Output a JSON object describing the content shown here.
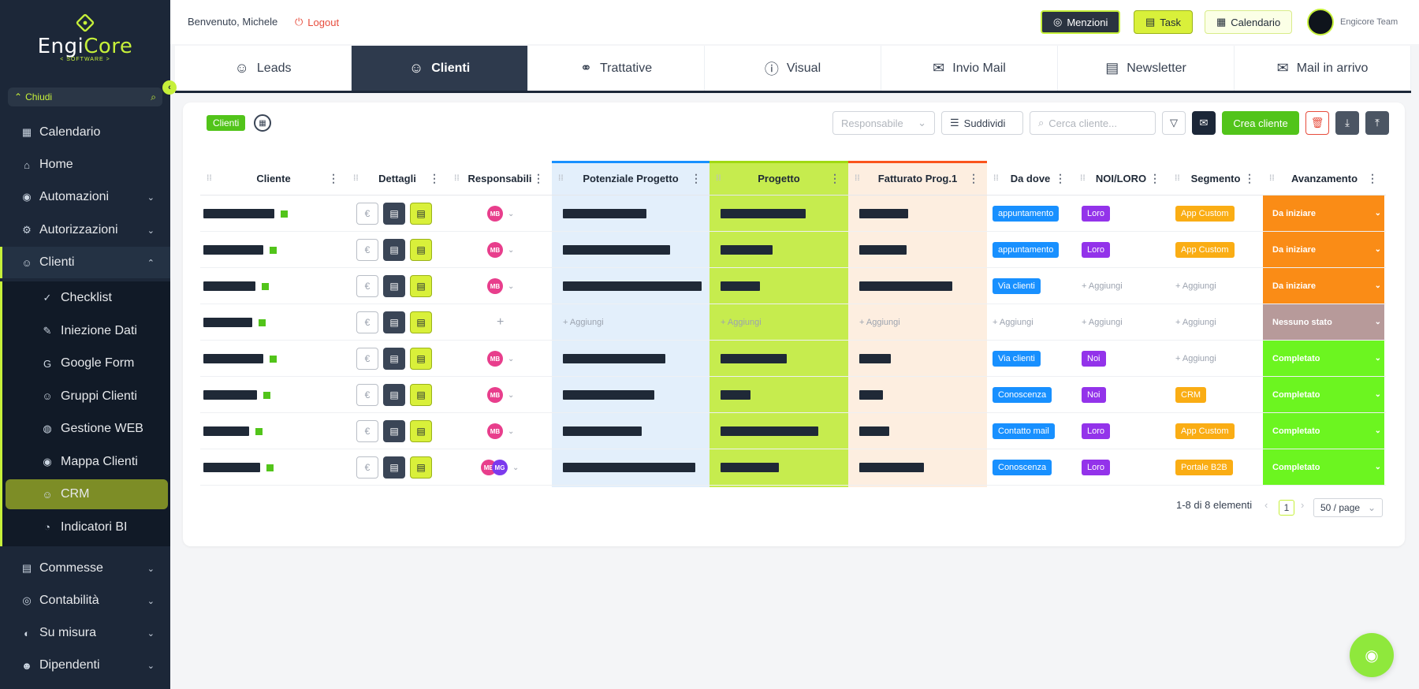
{
  "sidebar": {
    "logo": {
      "part1": "Engi",
      "part2": "Core",
      "sub": "< SOFTWARE >"
    },
    "collapse_label": "Chiudi",
    "items": [
      {
        "label": "Calendario",
        "icon": "calendar-icon"
      },
      {
        "label": "Home",
        "icon": "home-icon"
      },
      {
        "label": "Automazioni",
        "icon": "robot-icon"
      },
      {
        "label": "Autorizzazioni",
        "icon": "gear-icon"
      },
      {
        "label": "Clienti",
        "icon": "user-icon"
      },
      {
        "label": "Commesse",
        "icon": "document-icon"
      },
      {
        "label": "Contabilità",
        "icon": "currency-icon"
      },
      {
        "label": "Su misura",
        "icon": "wrench-icon"
      },
      {
        "label": "Dipendenti",
        "icon": "people-icon"
      }
    ],
    "sub_items": [
      {
        "label": "Checklist",
        "icon": "check-icon"
      },
      {
        "label": "Iniezione Dati",
        "icon": "edit-icon"
      },
      {
        "label": "Google Form",
        "icon": "google-icon"
      },
      {
        "label": "Gruppi Clienti",
        "icon": "group-icon"
      },
      {
        "label": "Gestione WEB",
        "icon": "globe-icon"
      },
      {
        "label": "Mappa Clienti",
        "icon": "map-pin-icon"
      },
      {
        "label": "CRM",
        "icon": "crm-icon"
      },
      {
        "label": "Indicatori BI",
        "icon": "gauge-icon"
      }
    ]
  },
  "topbar": {
    "welcome": "Benvenuto, Michele",
    "logout": "Logout",
    "menzioni": "Menzioni",
    "task": "Task",
    "calendario": "Calendario",
    "team": "Engicore Team"
  },
  "tabs": [
    "Leads",
    "Clienti",
    "Trattative",
    "Visual",
    "Invio Mail",
    "Newsletter",
    "Mail in arrivo"
  ],
  "toolbar": {
    "badge": "Clienti",
    "responsabile_placeholder": "Responsabile",
    "suddividi": "Suddividi",
    "search_placeholder": "Cerca cliente...",
    "crea": "Crea cliente"
  },
  "table": {
    "columns": [
      "Cliente",
      "Dettagli",
      "Responsabili",
      "Potenziale Progetto",
      "Progetto",
      "Fatturato Prog.1",
      "Da dove",
      "NOI/LORO",
      "Segmento",
      "Avanzamento"
    ],
    "add_label": "+ Aggiungi",
    "rows": [
      {
        "resp": [
          "MB"
        ],
        "da_dove": "appuntamento",
        "noi_loro": "Loro",
        "segmento": "App Custom",
        "stato": "Da iniziare"
      },
      {
        "resp": [
          "MB"
        ],
        "da_dove": "appuntamento",
        "noi_loro": "Loro",
        "segmento": "App Custom",
        "stato": "Da iniziare"
      },
      {
        "resp": [
          "MB"
        ],
        "da_dove": "Via clienti",
        "noi_loro": "",
        "segmento": "",
        "stato": "Da iniziare"
      },
      {
        "resp": [],
        "da_dove": "",
        "noi_loro": "",
        "segmento": "",
        "stato": "Nessuno stato"
      },
      {
        "resp": [
          "MB"
        ],
        "da_dove": "Via clienti",
        "noi_loro": "Noi",
        "segmento": "",
        "stato": "Completato"
      },
      {
        "resp": [
          "MB"
        ],
        "da_dove": "Conoscenza",
        "noi_loro": "Noi",
        "segmento": "CRM",
        "stato": "Completato"
      },
      {
        "resp": [
          "MB"
        ],
        "da_dove": "Contatto mail",
        "noi_loro": "Loro",
        "segmento": "App Custom",
        "stato": "Completato"
      },
      {
        "resp": [
          "MB",
          "MG"
        ],
        "da_dove": "Conoscenza",
        "noi_loro": "Loro",
        "segmento": "Portale B2B",
        "stato": "Completato"
      }
    ]
  },
  "pagination": {
    "summary": "1-8 di 8 elementi",
    "page": "1",
    "page_size": "50 / page"
  },
  "colors": {
    "accent": "#c6f03a",
    "sidebar": "#1c2738",
    "green": "#52c41a",
    "potenziale_bg": "#e3effb",
    "progetto_bg": "#c6ec4e",
    "fatturato_bg": "#fdeee0"
  }
}
